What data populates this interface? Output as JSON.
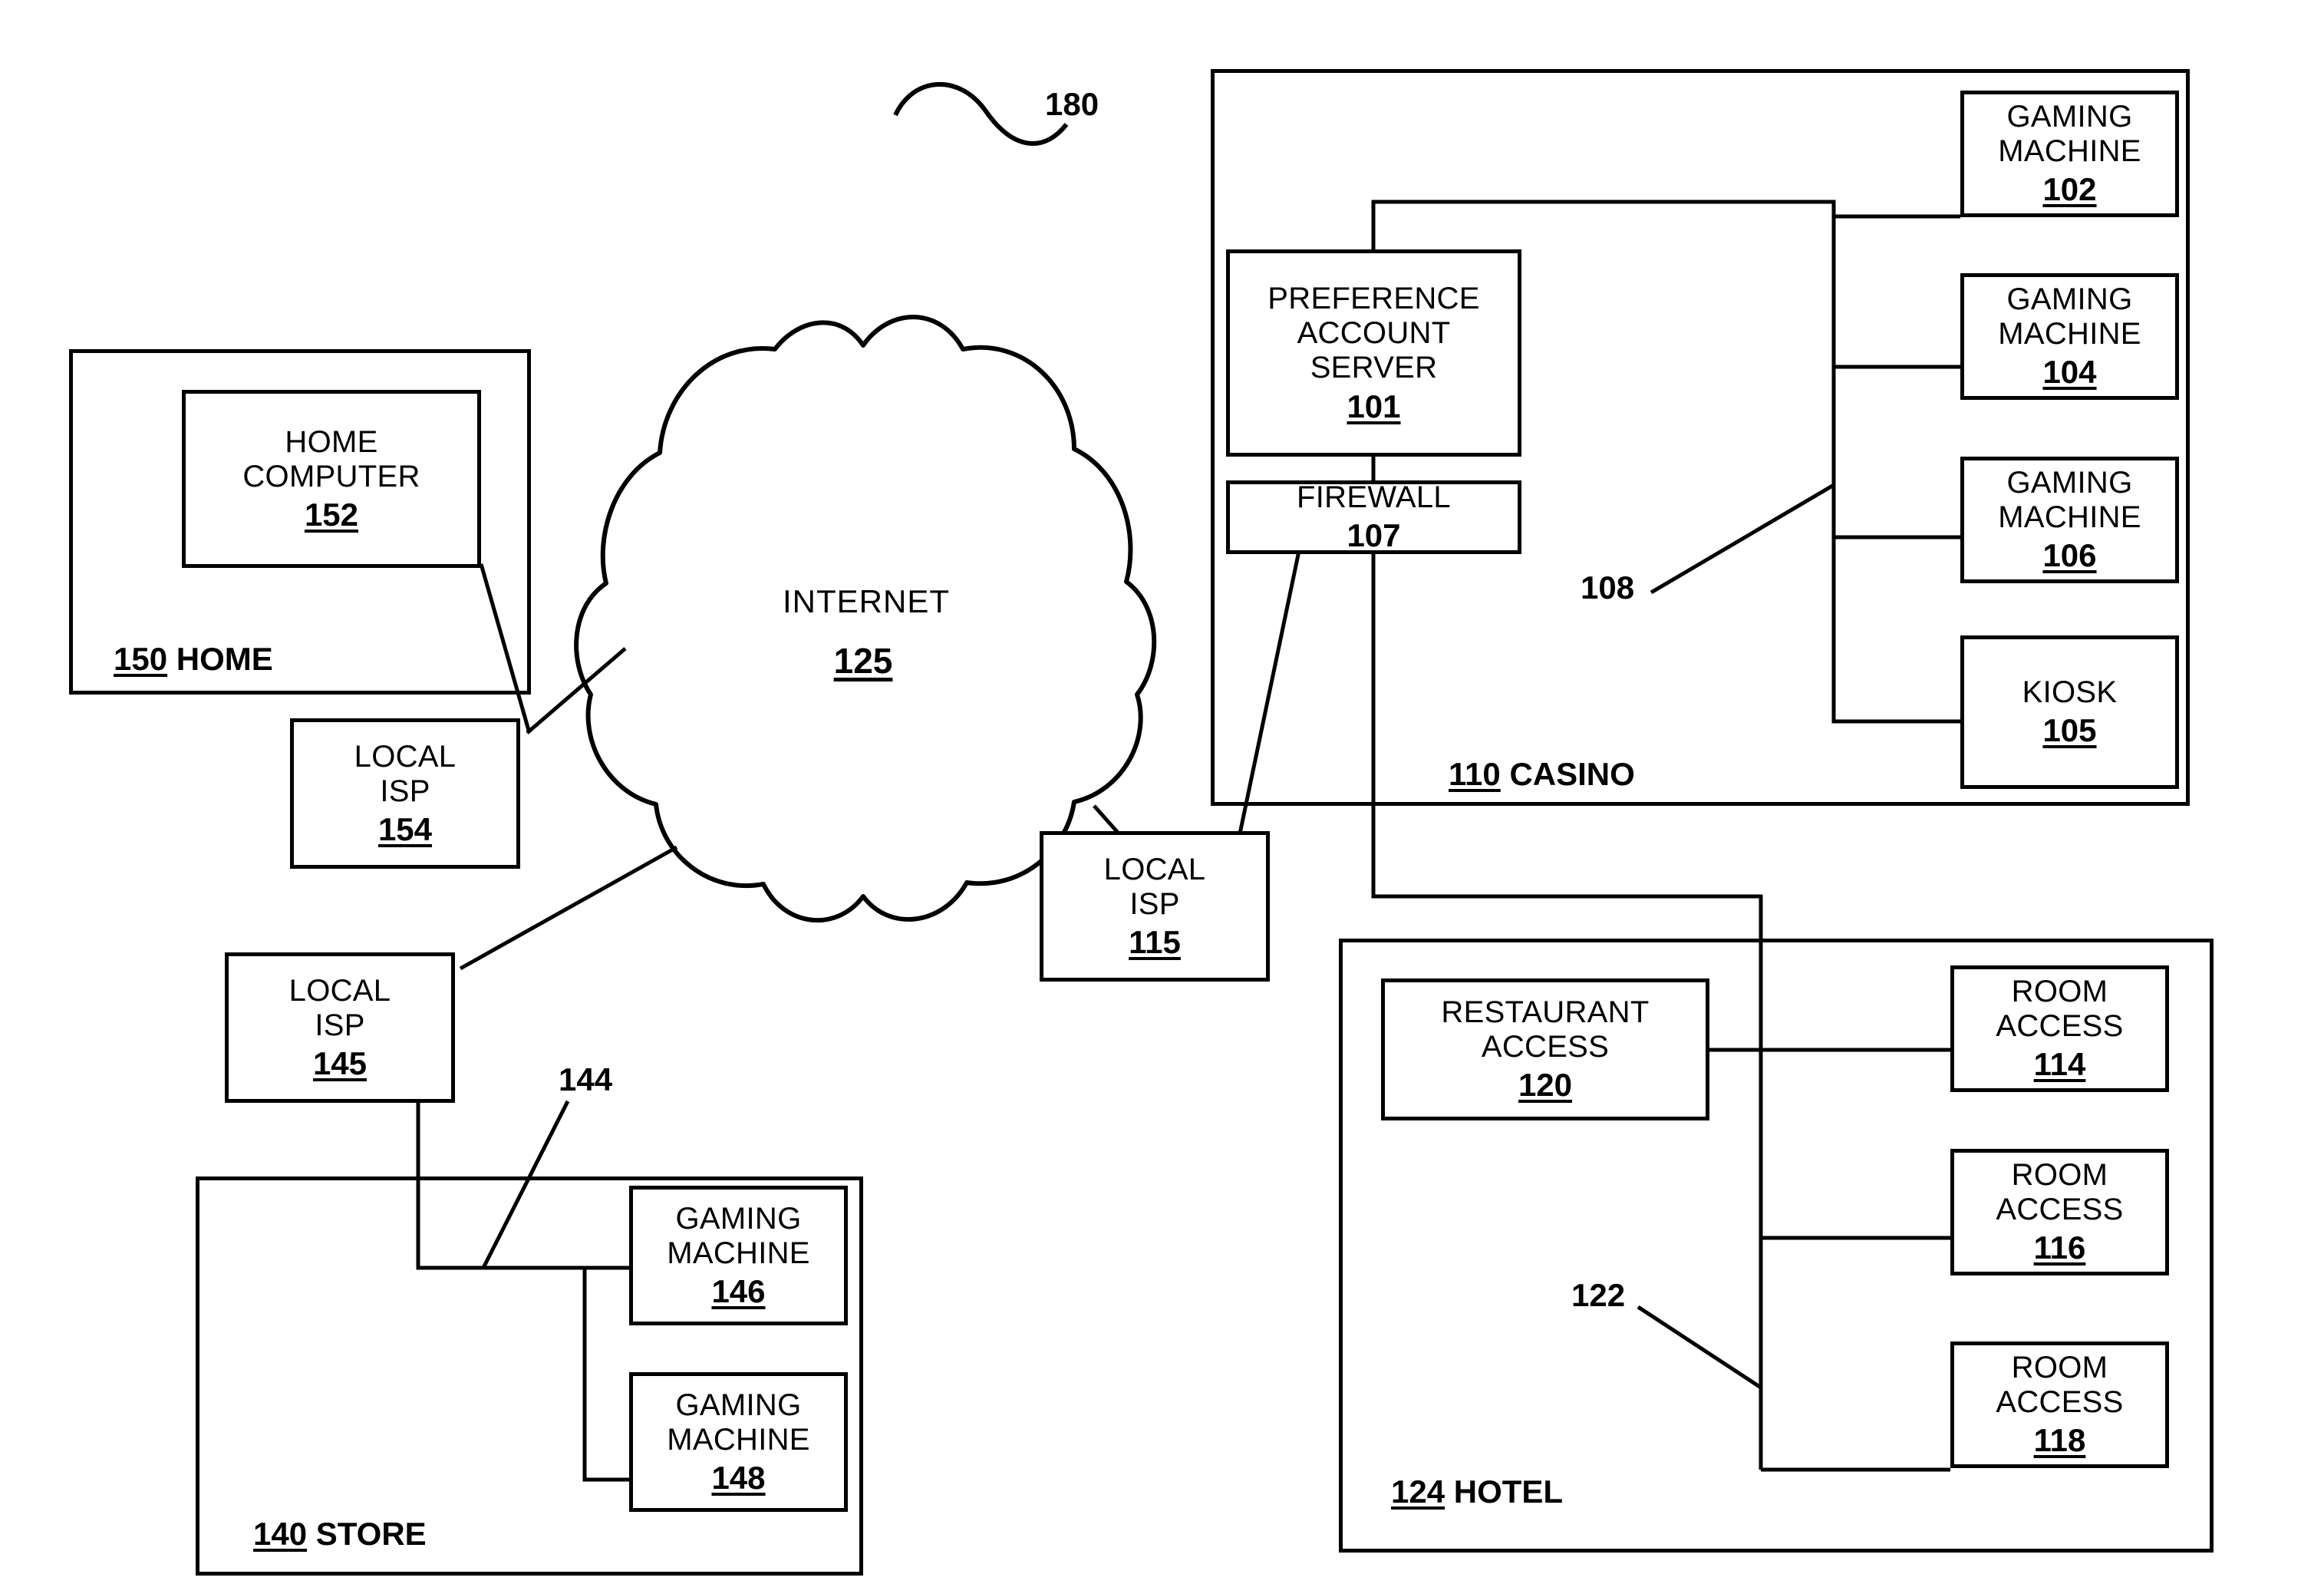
{
  "figure": {
    "ref_label": "180"
  },
  "cloud": {
    "name": "INTERNET",
    "number": "125"
  },
  "regions": {
    "home": {
      "number": "150",
      "name": "HOME"
    },
    "casino": {
      "number": "110",
      "name": "CASINO"
    },
    "store": {
      "number": "140",
      "name": "STORE"
    },
    "hotel": {
      "number": "124",
      "name": "HOTEL"
    }
  },
  "refs": {
    "casino_bus": "108",
    "store_bus": "144",
    "hotel_bus": "122"
  },
  "boxes": {
    "home_computer": {
      "lines": [
        "HOME",
        "COMPUTER"
      ],
      "number": "152"
    },
    "local_isp_154": {
      "lines": [
        "LOCAL",
        "ISP"
      ],
      "number": "154"
    },
    "local_isp_145": {
      "lines": [
        "LOCAL",
        "ISP"
      ],
      "number": "145"
    },
    "local_isp_115": {
      "lines": [
        "LOCAL",
        "ISP"
      ],
      "number": "115"
    },
    "preference_account_server": {
      "lines": [
        "PREFERENCE",
        "ACCOUNT",
        "SERVER"
      ],
      "number": "101"
    },
    "firewall": {
      "lines": [
        "FIREWALL"
      ],
      "number": "107"
    },
    "gaming_machine_102": {
      "lines": [
        "GAMING",
        "MACHINE"
      ],
      "number": "102"
    },
    "gaming_machine_104": {
      "lines": [
        "GAMING",
        "MACHINE"
      ],
      "number": "104"
    },
    "gaming_machine_106": {
      "lines": [
        "GAMING",
        "MACHINE"
      ],
      "number": "106"
    },
    "kiosk_105": {
      "lines": [
        "KIOSK"
      ],
      "number": "105"
    },
    "gaming_machine_146": {
      "lines": [
        "GAMING",
        "MACHINE"
      ],
      "number": "146"
    },
    "gaming_machine_148": {
      "lines": [
        "GAMING",
        "MACHINE"
      ],
      "number": "148"
    },
    "restaurant_access_120": {
      "lines": [
        "RESTAURANT",
        "ACCESS"
      ],
      "number": "120"
    },
    "room_access_114": {
      "lines": [
        "ROOM",
        "ACCESS"
      ],
      "number": "114"
    },
    "room_access_116": {
      "lines": [
        "ROOM",
        "ACCESS"
      ],
      "number": "116"
    },
    "room_access_118": {
      "lines": [
        "ROOM",
        "ACCESS"
      ],
      "number": "118"
    }
  },
  "colors": {
    "stroke": "#000000",
    "background": "#ffffff"
  }
}
